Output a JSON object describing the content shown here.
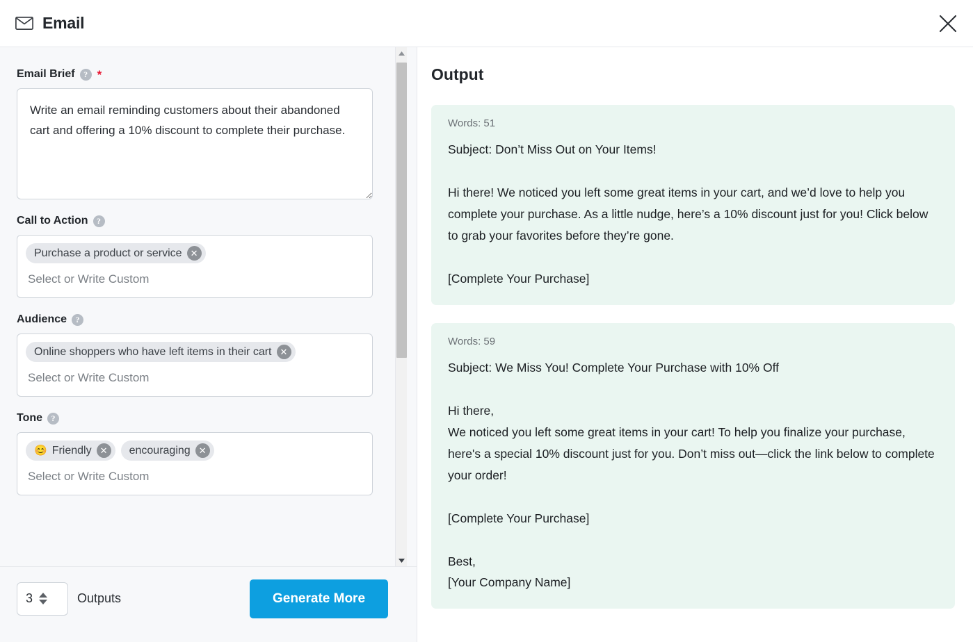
{
  "header": {
    "title": "Email",
    "mail_icon": "envelope-icon",
    "close_icon": "close-icon"
  },
  "form": {
    "fields": [
      {
        "label": "Email Brief",
        "help_icon": "help-icon",
        "required": true,
        "required_marker": "*",
        "type": "textarea",
        "value": "Write an email reminding customers about their abandoned cart and offering a 10% discount to complete their purchase."
      },
      {
        "label": "Call to Action",
        "help_icon": "help-icon",
        "required": false,
        "type": "tags",
        "placeholder": "Select or Write Custom",
        "tags": [
          {
            "emoji": "",
            "label": "Purchase a product or service"
          }
        ]
      },
      {
        "label": "Audience",
        "help_icon": "help-icon",
        "required": false,
        "type": "tags",
        "placeholder": "Select or Write Custom",
        "tags": [
          {
            "emoji": "",
            "label": "Online shoppers who have left items in their cart"
          }
        ]
      },
      {
        "label": "Tone",
        "help_icon": "help-icon",
        "required": false,
        "type": "tags",
        "placeholder": "Select or Write Custom",
        "tags": [
          {
            "emoji": "😊",
            "label": "Friendly"
          },
          {
            "emoji": "",
            "label": "encouraging"
          }
        ]
      }
    ],
    "scrollbar": {
      "up_arrow_icon": "scroll-up-arrow-icon",
      "down_arrow_icon": "scroll-down-arrow-icon"
    }
  },
  "footer": {
    "count_value": "3",
    "count_label": "Outputs",
    "generate_label": "Generate More",
    "accent_color": "#0d9fe0"
  },
  "output": {
    "title": "Output",
    "card_color": "#eaf6f1",
    "cards": [
      {
        "words_label": "Words: 51",
        "text": "Subject: Don’t Miss Out on Your Items!\n\nHi there! We noticed you left some great items in your cart, and we’d love to help you complete your purchase. As a little nudge, here’s a 10% discount just for you! Click below to grab your favorites before they’re gone.\n\n[Complete Your Purchase]"
      },
      {
        "words_label": "Words: 59",
        "text": "Subject: We Miss You! Complete Your Purchase with 10% Off\n\nHi there,\nWe noticed you left some great items in your cart! To help you finalize your purchase, here's a special 10% discount just for you. Don’t miss out—click the link below to complete your order!\n\n[Complete Your Purchase]\n\nBest,\n[Your Company Name]"
      }
    ]
  }
}
